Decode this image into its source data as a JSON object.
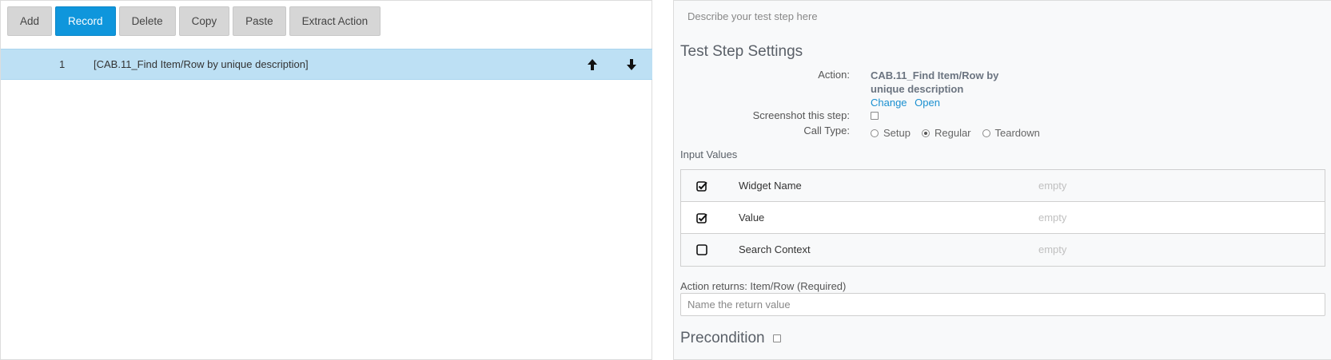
{
  "toolbar": {
    "add": "Add",
    "record": "Record",
    "delete": "Delete",
    "copy": "Copy",
    "paste": "Paste",
    "extract_action": "Extract Action"
  },
  "steps": [
    {
      "number": "1",
      "name": "[CAB.11_Find Item/Row by unique description]"
    }
  ],
  "description": {
    "placeholder": "Describe your test step here"
  },
  "settings": {
    "title": "Test Step Settings",
    "action_label": "Action:",
    "action_name_line1": "CAB.11_Find Item/Row by",
    "action_name_line2": "unique description",
    "change_link": "Change",
    "open_link": "Open",
    "screenshot_label": "Screenshot this step:",
    "call_type_label": "Call Type:",
    "call_types": [
      "Setup",
      "Regular",
      "Teardown"
    ],
    "call_type_selected": "Regular"
  },
  "input_values": {
    "label": "Input Values",
    "rows": [
      {
        "name": "Widget Name",
        "value": "empty",
        "checked": true
      },
      {
        "name": "Value",
        "value": "empty",
        "checked": true
      },
      {
        "name": "Search Context",
        "value": "empty",
        "checked": false
      }
    ]
  },
  "returns": {
    "label": "Action returns: Item/Row (Required)",
    "placeholder": "Name the return value"
  },
  "precondition": {
    "label": "Precondition"
  },
  "colors": {
    "primary": "#0f96dc",
    "selected_row": "#bde0f4",
    "link": "#1a8fd0"
  }
}
